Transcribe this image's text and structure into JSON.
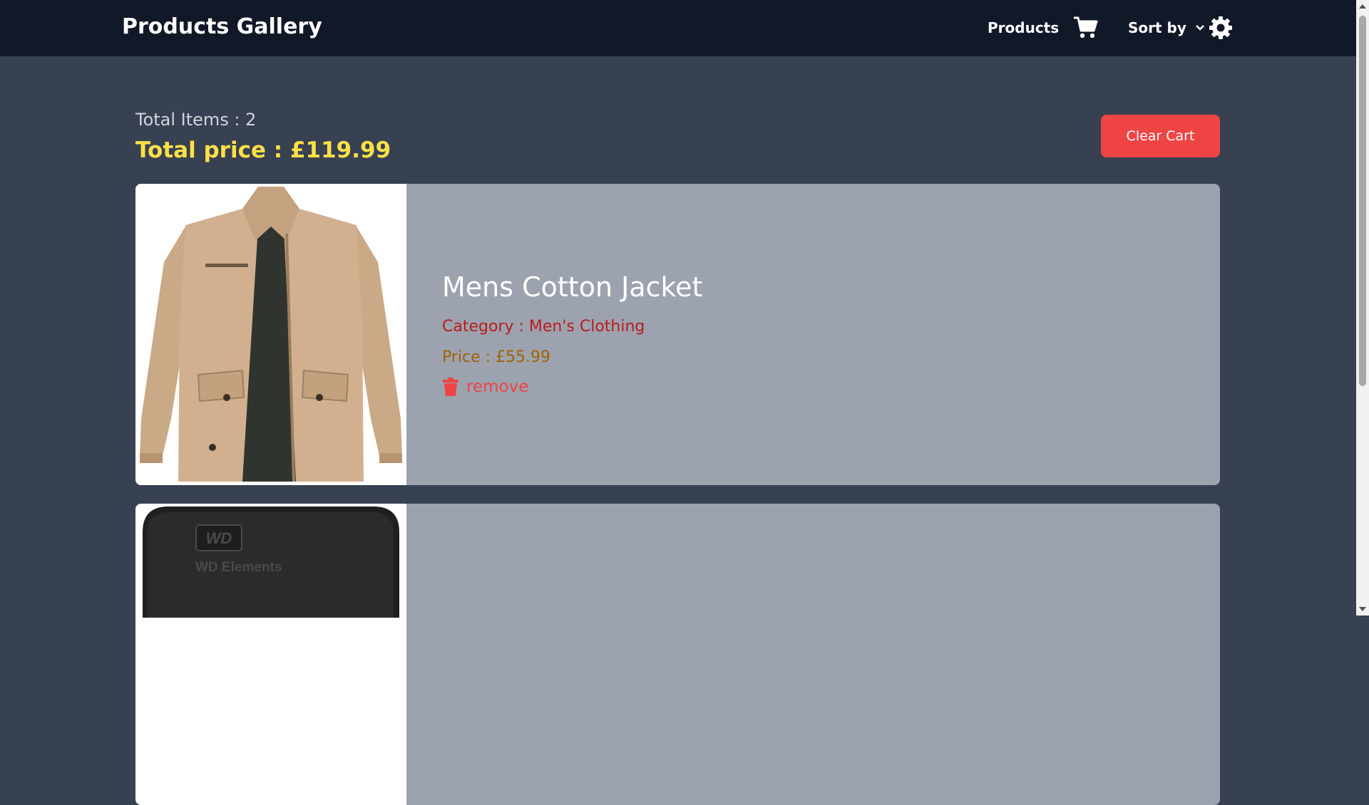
{
  "navbar": {
    "brand": "Products Gallery",
    "products_link": "Products",
    "cart_icon": "shopping-cart-icon",
    "sort_label": "Sort by",
    "sort_icon": "chevron-down-icon",
    "settings_icon": "gear-icon"
  },
  "summary": {
    "total_items": "Total Items : 2",
    "total_price": "Total price : £119.99",
    "clear_cart_label": "Clear Cart"
  },
  "cart_items": [
    {
      "title": "Mens Cotton Jacket",
      "category": "Category : Men's Clothing",
      "price": "Price : £55.99",
      "remove_label": "remove",
      "image": "mens-cotton-jacket-image"
    },
    {
      "title": "",
      "image": "wd-elements-hard-drive-image",
      "image_text_brand": "WD",
      "image_text_product": "WD Elements"
    }
  ],
  "colors": {
    "navbar_bg": "#111827",
    "page_bg": "#374151",
    "card_bg": "#9ca3af",
    "price_total": "#fde047",
    "clear_cart_bg": "#ef4444",
    "category": "#b91c1c",
    "price": "#a16207",
    "remove": "#ef4444"
  }
}
